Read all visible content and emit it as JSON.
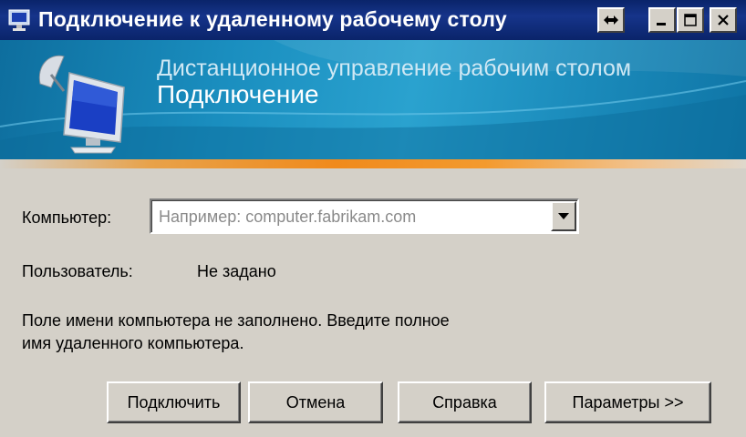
{
  "window": {
    "title": "Подключение к удаленному рабочему столу",
    "controls": {
      "resize_icon": "double-arrow-icon",
      "minimize_icon": "minimize-icon",
      "maximize_icon": "maximize-icon",
      "close_icon": "close-icon"
    }
  },
  "banner": {
    "subtitle": "Дистанционное управление рабочим столом",
    "title": "Подключение",
    "icon": "remote-desktop-monitor-icon"
  },
  "form": {
    "computer_label": "Компьютер:",
    "computer_placeholder": "Например: computer.fabrikam.com",
    "user_label": "Пользователь:",
    "user_value": "Не задано",
    "message_line1": "Поле имени компьютера не заполнено. Введите полное",
    "message_line2": "имя удаленного компьютера."
  },
  "buttons": {
    "connect": "Подключить",
    "cancel": "Отмена",
    "help": "Справка",
    "options": "Параметры >>"
  },
  "colors": {
    "titlebar": "#0a246a",
    "banner": "#1a8ebf",
    "accent_strip": "#f08a1c",
    "face": "#d4d0c8"
  }
}
